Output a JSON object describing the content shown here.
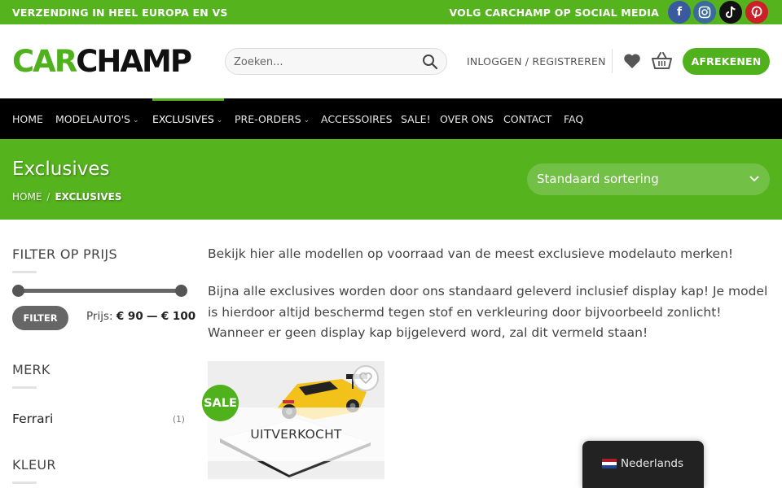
{
  "topbar": {
    "left_text": "VERZENDING IN HEEL EUROPA EN VS",
    "right_text": "VOLG CARCHAMP OP SOCIAL MEDIA",
    "socials": [
      "facebook-icon",
      "instagram-icon",
      "tiktok-icon",
      "pinterest-icon"
    ]
  },
  "header": {
    "logo_part1": "CAR",
    "logo_part2": "CHAMP",
    "search_placeholder": "Zoeken...",
    "login_label": "INLOGGEN / REGISTREREN",
    "checkout_label": "AFREKENEN"
  },
  "nav": {
    "items": [
      {
        "label": "HOME",
        "dropdown": false
      },
      {
        "label": "MODELAUTO'S",
        "dropdown": true
      },
      {
        "label": "EXCLUSIVES",
        "dropdown": true,
        "active": true
      },
      {
        "label": "PRE-ORDERS",
        "dropdown": true
      },
      {
        "label": "ACCESSOIRES",
        "dropdown": false
      },
      {
        "label": "SALE!",
        "dropdown": false
      },
      {
        "label": "OVER ONS",
        "dropdown": false
      },
      {
        "label": "CONTACT",
        "dropdown": false
      },
      {
        "label": "FAQ",
        "dropdown": false
      }
    ]
  },
  "banner": {
    "title": "Exclusives",
    "breadcrumb_home": "HOME",
    "breadcrumb_sep": "/",
    "breadcrumb_current": "EXCLUSIVES",
    "sort_label": "Standaard sortering"
  },
  "sidebar": {
    "price_title": "FILTER OP PRIJS",
    "filter_button": "FILTER",
    "price_prefix": "Prijs:",
    "price_min": "€ 90",
    "price_dash": "—",
    "price_max": "€ 100",
    "brand_title": "MERK",
    "brands": [
      {
        "name": "Ferrari",
        "count": "(1)"
      }
    ],
    "color_title": "KLEUR"
  },
  "main": {
    "intro": "Bekijk hier alle modellen op voorraad van de meest exclusieve modelauto merken!",
    "body": "Bijna alle exclusives worden door ons standaard geleverd inclusief display kap! Je model is hierdoor altijd beschermd tegen stof en verkleuring door bijvoorbeeld zonlicht! Wanneer er geen display kap bijgeleverd word, zal dit vermeld staan!",
    "product": {
      "badge": "SALE",
      "status": "UITVERKOCHT"
    }
  },
  "language": {
    "label": "Nederlands"
  },
  "colors": {
    "brand_green": "#55b31e",
    "button_green": "#4fb11b",
    "nav_bg": "#000000"
  }
}
